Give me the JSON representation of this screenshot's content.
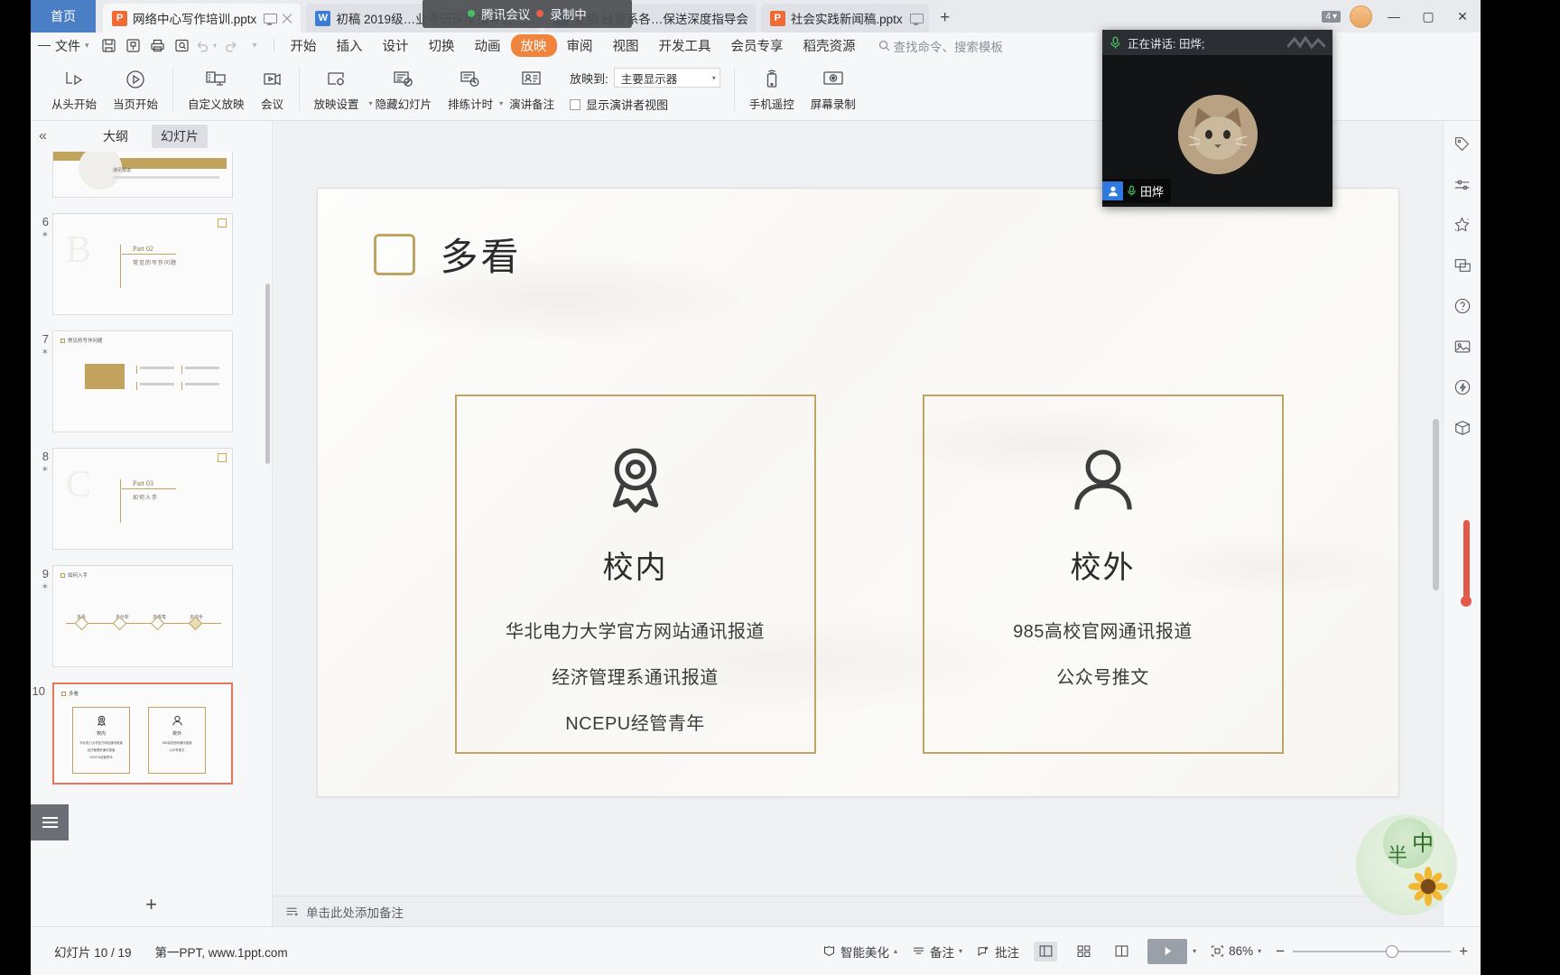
{
  "window": {
    "home_tab": "首页",
    "controls": {
      "minimize": "—",
      "maximize": "▢",
      "close": "✕"
    },
    "badge_count": "4"
  },
  "tabs": [
    {
      "label": "网络中心写作培训.pptx",
      "type": "ppt",
      "icon": "powerpoint-file-icon",
      "active": true
    },
    {
      "label": "初稿 2019级…业考研深度指导会",
      "type": "doc",
      "icon": "word-file-icon",
      "active": false
    },
    {
      "label": "定稿 经管系各…保送深度指导会",
      "type": "doc",
      "icon": "word-file-icon",
      "active": false
    },
    {
      "label": "社会实践新闻稿.pptx",
      "type": "ppt",
      "icon": "powerpoint-file-icon",
      "active": false
    }
  ],
  "record_overlay": {
    "app": "腾讯会议",
    "status": "录制中"
  },
  "menu": {
    "file_label": "文件",
    "quick_icons": [
      "save-icon",
      "save-as-icon",
      "print-icon",
      "print-preview-icon",
      "undo-icon",
      "redo-icon",
      "customize-icon"
    ],
    "items": [
      "开始",
      "插入",
      "设计",
      "切换",
      "动画",
      "放映",
      "审阅",
      "视图",
      "开发工具",
      "会员专享",
      "稻壳资源"
    ],
    "active": "放映",
    "search_placeholder": "查找命令、搜索模板"
  },
  "ribbon": {
    "buttons": [
      {
        "label": "从头开始",
        "icon": "start-from-beginning-icon"
      },
      {
        "label": "当页开始",
        "icon": "start-from-current-icon"
      },
      {
        "label": "自定义放映",
        "icon": "custom-show-icon"
      },
      {
        "label": "会议",
        "icon": "meeting-icon"
      },
      {
        "label": "放映设置",
        "icon": "show-settings-icon",
        "dropdown": true
      },
      {
        "label": "隐藏幻灯片",
        "icon": "hide-slide-icon"
      },
      {
        "label": "排练计时",
        "icon": "rehearse-timing-icon",
        "dropdown": true
      },
      {
        "label": "演讲备注",
        "icon": "speaker-notes-icon"
      }
    ],
    "project_to_label": "放映到:",
    "project_to_value": "主要显示器",
    "presenter_view_label": "显示演讲者视图",
    "presenter_view_checked": false,
    "right_buttons": [
      {
        "label": "手机遥控",
        "icon": "phone-remote-icon"
      },
      {
        "label": "屏幕录制",
        "icon": "screen-record-icon"
      }
    ]
  },
  "thumbnails": {
    "collapse_icon": "collapse-chevrons-icon",
    "tabs": [
      {
        "label": "大纲",
        "selected": false
      },
      {
        "label": "幻灯片",
        "selected": true
      }
    ],
    "slides": [
      {
        "num": "5",
        "star": "✶",
        "title": "通讯报道",
        "kind": "partial",
        "selected": false
      },
      {
        "num": "6",
        "star": "✶",
        "title": "Part 02",
        "subtitle": "常见的写作问题",
        "kind": "part",
        "selected": false
      },
      {
        "num": "7",
        "star": "✶",
        "title": "常见的写作问题",
        "kind": "problems",
        "selected": false
      },
      {
        "num": "8",
        "star": "✶",
        "title": "Part 03",
        "subtitle": "如何入手",
        "kind": "part",
        "selected": false
      },
      {
        "num": "9",
        "star": "✶",
        "title": "如何入手",
        "kind": "timeline",
        "selected": false,
        "steps": [
          "多看",
          "多分析",
          "多练笔",
          "多动手"
        ]
      },
      {
        "num": "10",
        "star": "",
        "title": "多看",
        "kind": "current",
        "selected": true
      }
    ],
    "add_slide_icon": "add-slide-icon",
    "outline_toggle_icon": "outline-list-icon"
  },
  "slide": {
    "title": "多看",
    "cards": [
      {
        "icon": "award-medal-icon",
        "heading": "校内",
        "lines": [
          "华北电力大学官方网站通讯报道",
          "经济管理系通讯报道",
          "NCEPU经管青年"
        ]
      },
      {
        "icon": "person-icon",
        "heading": "校外",
        "lines": [
          "985高校官网通讯报道",
          "公众号推文"
        ]
      }
    ],
    "accent_color": "#bfa463"
  },
  "right_tools": [
    "tag-icon",
    "slider-settings-icon",
    "sparkle-star-icon",
    "screen-share-icon",
    "help-circle-icon",
    "image-edit-icon",
    "lightning-shield-icon",
    "package-icon"
  ],
  "notes": {
    "placeholder": "单击此处添加备注",
    "icon": "notes-add-icon"
  },
  "status": {
    "slide_counter": "幻灯片 10 / 19",
    "template_credit": "第一PPT, www.1ppt.com",
    "beautify": "智能美化",
    "notes_btn": "备注",
    "comment_btn": "批注",
    "views": [
      "normal-view-icon",
      "slide-sorter-icon",
      "reading-view-icon"
    ],
    "selected_view": "normal-view-icon",
    "play_icon": "play-slideshow-icon",
    "fit_icon": "fit-to-window-icon",
    "zoom_value": "86%",
    "zoom_minus": "−",
    "zoom_plus": "+"
  },
  "meeting": {
    "speaking_label": "正在讲话: 田烨;",
    "mic_icon": "microphone-icon",
    "participant_name": "田烨",
    "participant_icon": "participant-avatar-icon",
    "participant_mic_icon": "microphone-small-icon"
  },
  "watermark": {
    "char1": "半",
    "char2": "中"
  }
}
